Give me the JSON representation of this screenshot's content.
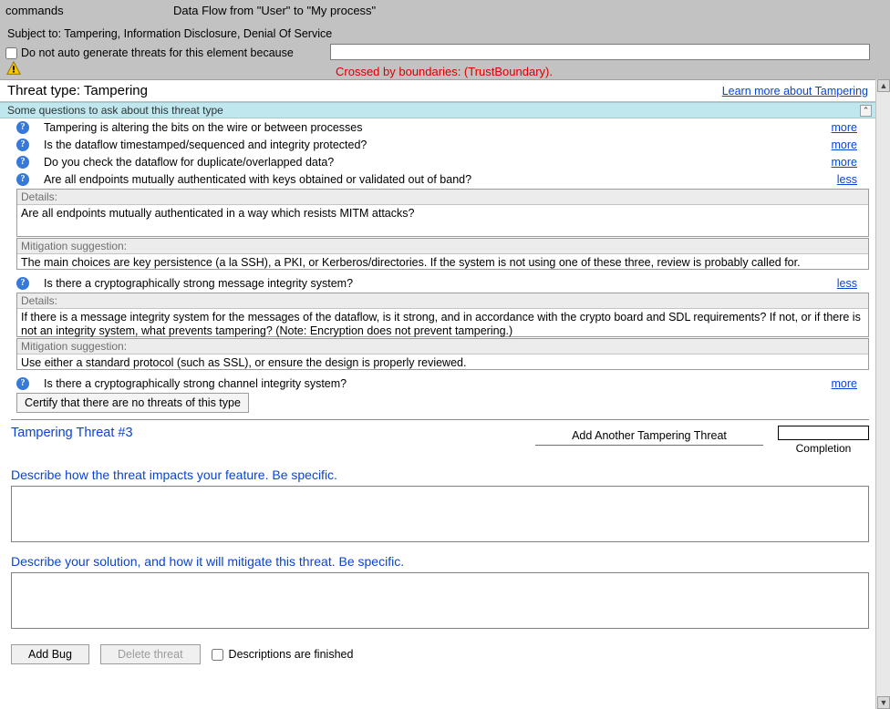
{
  "header": {
    "commands": "commands",
    "flow_title": "Data Flow from \"User\" to \"My process\"",
    "subject_to": "Subject to: Tampering, Information Disclosure, Denial Of Service",
    "no_auto": "Do not auto generate threats for this element because",
    "crossed": "Crossed by boundaries: (TrustBoundary)."
  },
  "threat": {
    "type_label": "Threat type: Tampering",
    "learn_more": "Learn more about Tampering",
    "questions_header": "Some questions to ask about this threat type",
    "questions": [
      {
        "text": "Tampering is altering the bits on the wire or between processes",
        "link": "more"
      },
      {
        "text": "Is the dataflow timestamped/sequenced and integrity protected?",
        "link": "more"
      },
      {
        "text": "Do you check the dataflow for duplicate/overlapped data?",
        "link": "more"
      },
      {
        "text": "Are all endpoints mutually authenticated with keys obtained or validated out of band?",
        "link": "less"
      }
    ],
    "detail1": {
      "hdr": "Details:",
      "body": "Are all endpoints mutually authenticated in a way which resists MITM attacks?"
    },
    "mit1": {
      "hdr": "Mitigation suggestion:",
      "body": "The main choices are key persistence (a la SSH), a PKI, or Kerberos/directories.  If the system is not using one of these three, review is probably called for."
    },
    "q5": {
      "text": "Is there a cryptographically strong message integrity system?",
      "link": "less"
    },
    "detail2": {
      "hdr": "Details:",
      "body": "If there is a message integrity system for the messages of the dataflow, is it strong, and in accordance with the crypto board and SDL requirements?  If not, or if there is not an integrity system, what prevents tampering?  (Note: Encryption does not prevent tampering.)"
    },
    "mit2": {
      "hdr": "Mitigation suggestion:",
      "body": "Use either a standard protocol (such as SSL), or ensure the design is properly reviewed."
    },
    "q6": {
      "text": "Is there a cryptographically strong channel integrity system?",
      "link": "more"
    },
    "certify": "Certify that there are no threats of this type"
  },
  "panel": {
    "title": "Tampering Threat #3",
    "add_another": "Add Another Tampering Threat",
    "completion": "Completion",
    "prompt1": "Describe how the threat impacts your feature.  Be specific.",
    "prompt2": "Describe your solution, and how it will mitigate this threat.  Be specific.",
    "add_bug": "Add Bug",
    "delete": "Delete threat",
    "finished": "Descriptions are finished"
  }
}
